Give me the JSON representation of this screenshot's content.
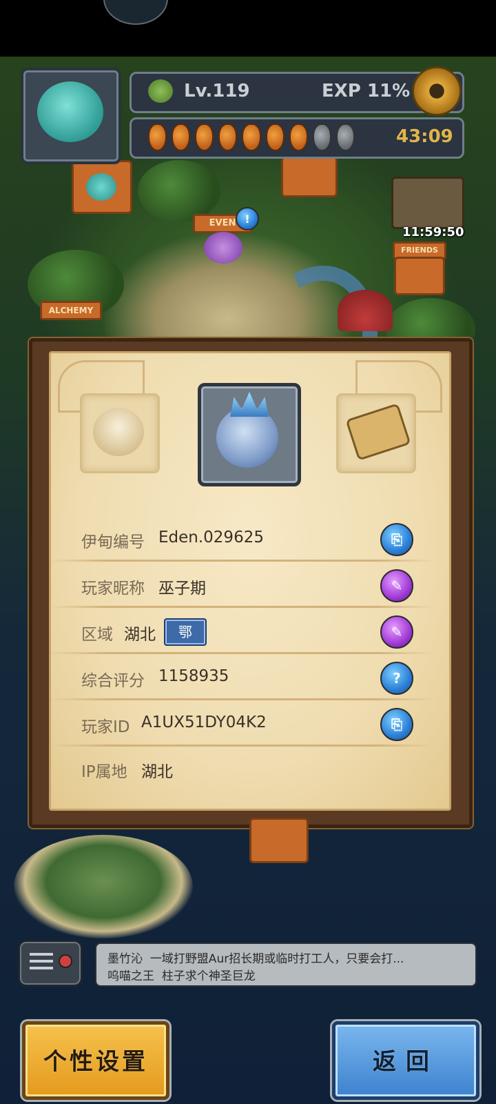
{
  "hud": {
    "level": "Lv.119",
    "exp": "EXP 11%",
    "energy_timer": "43:09",
    "energy": {
      "filled": 7,
      "total": 9
    },
    "friends_timer": "11:59:50"
  },
  "map": {
    "labels": {
      "event": "EVEN",
      "friends": "FRIENDS",
      "alchemy": "ALCHEMY"
    }
  },
  "profile": {
    "rows": [
      {
        "label": "伊甸编号",
        "value": "Eden.029625",
        "action": "copy-icon"
      },
      {
        "label": "玩家昵称",
        "value": "巫子期",
        "action": "edit-icon"
      },
      {
        "label": "区域",
        "value": "湖北",
        "tag": "鄂",
        "action": "edit-icon"
      },
      {
        "label": "综合评分",
        "value": "1158935",
        "action": "help-icon"
      },
      {
        "label": "玩家ID",
        "value": "A1UX51DY04K2",
        "action": "copy-icon"
      },
      {
        "label": "IP属地",
        "value": "湖北"
      }
    ]
  },
  "chat": {
    "messages": [
      {
        "user": "墨竹沁",
        "text": "一域打野盟Aur招长期或临时打工人，只要会打..."
      },
      {
        "user": "呜喵之王",
        "text": "柱子求个神圣巨龙"
      }
    ]
  },
  "buttons": {
    "settings": "个性设置",
    "back": "返回"
  },
  "colors": {
    "gold_button": "#e49a1c",
    "blue_button": "#3d82cf",
    "badge_blue": "#2b7fd6",
    "badge_purple": "#a13bd6"
  }
}
